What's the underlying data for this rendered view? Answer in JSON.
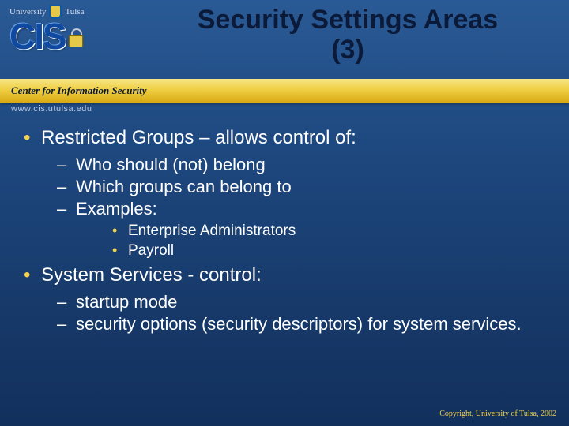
{
  "header": {
    "university_left": "University",
    "university_right": "Tulsa",
    "org_acronym": "CIS",
    "org_full": "Center for Information Security",
    "url": "www.cis.utulsa.edu",
    "slide_title_line1": "Security Settings Areas",
    "slide_title_line2": "(3)"
  },
  "bullets": {
    "b1": "Restricted Groups – allows control of:",
    "b1_sub": [
      "Who should (not) belong",
      "Which groups can belong to",
      "Examples:"
    ],
    "b1_subsub": [
      "Enterprise Administrators",
      "Payroll"
    ],
    "b2": "System Services -  control:",
    "b2_sub": [
      "startup mode",
      "security options (security descriptors) for system services."
    ]
  },
  "footer": "Copyright, University of Tulsa, 2002"
}
